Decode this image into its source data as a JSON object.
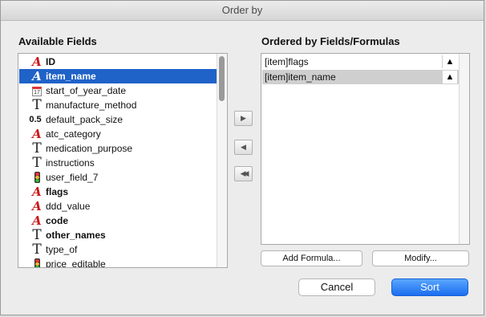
{
  "window": {
    "title": "Order by"
  },
  "available": {
    "heading": "Available Fields",
    "items": [
      {
        "label": "ID",
        "icon": "alpha-field-icon",
        "bold": true,
        "selected": false
      },
      {
        "label": "item_name",
        "icon": "alpha-field-icon",
        "bold": true,
        "selected": true
      },
      {
        "label": "start_of_year_date",
        "icon": "calendar-icon",
        "bold": false,
        "selected": false
      },
      {
        "label": "manufacture_method",
        "icon": "text-field-icon",
        "bold": false,
        "selected": false
      },
      {
        "label": "default_pack_size",
        "icon": "number-field-icon",
        "bold": false,
        "selected": false
      },
      {
        "label": "atc_category",
        "icon": "alpha-field-icon",
        "bold": false,
        "selected": false
      },
      {
        "label": "medication_purpose",
        "icon": "text-field-icon",
        "bold": false,
        "selected": false
      },
      {
        "label": "instructions",
        "icon": "text-field-icon",
        "bold": false,
        "selected": false
      },
      {
        "label": "user_field_7",
        "icon": "traffic-light-icon",
        "bold": false,
        "selected": false
      },
      {
        "label": "flags",
        "icon": "alpha-field-icon",
        "bold": true,
        "selected": false
      },
      {
        "label": "ddd_value",
        "icon": "alpha-field-icon",
        "bold": false,
        "selected": false
      },
      {
        "label": "code",
        "icon": "alpha-field-icon",
        "bold": true,
        "selected": false
      },
      {
        "label": "other_names",
        "icon": "text-field-icon",
        "bold": true,
        "selected": false
      },
      {
        "label": "type_of",
        "icon": "text-field-icon",
        "bold": false,
        "selected": false
      },
      {
        "label": "price_editable",
        "icon": "traffic-light-icon",
        "bold": false,
        "selected": false
      }
    ],
    "icon_glyphs": {
      "alpha": "A",
      "text": "T",
      "number": "0.5",
      "calendar": "17"
    }
  },
  "ordered": {
    "heading": "Ordered by Fields/Formulas",
    "items": [
      {
        "label": "[item]flags",
        "direction": "▲",
        "selected": false
      },
      {
        "label": "[item]item_name",
        "direction": "▲",
        "selected": true
      }
    ]
  },
  "transfer": {
    "add": {
      "glyph": "▶",
      "icon": "add-arrow-icon"
    },
    "remove": {
      "glyph": "◀",
      "icon": "remove-arrow-icon"
    },
    "remove_all": {
      "glyph": "◀◀",
      "icon": "remove-all-arrow-icon"
    }
  },
  "buttons": {
    "add_formula": "Add Formula...",
    "modify": "Modify...",
    "cancel": "Cancel",
    "sort": "Sort"
  },
  "colors": {
    "selection": "#1f62c8",
    "alpha_icon": "#cc1818",
    "default_button": "#1b6ef0"
  }
}
